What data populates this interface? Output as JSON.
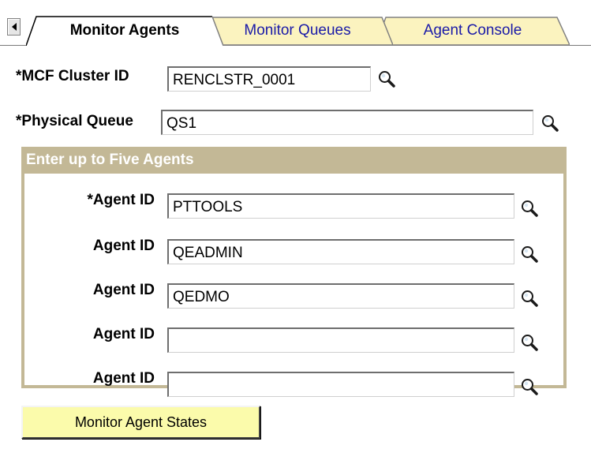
{
  "tabs": [
    {
      "label": "Monitor Agents",
      "active": true
    },
    {
      "label": "Monitor Queues",
      "active": false
    },
    {
      "label": "Agent Console",
      "active": false
    }
  ],
  "form": {
    "cluster": {
      "label": "*MCF Cluster ID",
      "value": "RENCLSTR_0001"
    },
    "queue": {
      "label": "*Physical Queue",
      "value": "QS1"
    }
  },
  "agents_group": {
    "title": "Enter up to Five Agents",
    "rows": [
      {
        "label": "*Agent ID",
        "value": "PTTOOLS"
      },
      {
        "label": "Agent ID",
        "value": "QEADMIN"
      },
      {
        "label": "Agent ID",
        "value": "QEDMO"
      },
      {
        "label": "Agent ID",
        "value": ""
      },
      {
        "label": "Agent ID",
        "value": ""
      }
    ]
  },
  "actions": {
    "monitor_label": "Monitor Agent States"
  },
  "colors": {
    "tab_active_bg": "#ffffff",
    "tab_inactive_bg": "#fbf3bf",
    "tab_inactive_text": "#1a1aa8",
    "group_header_bg": "#c3b896",
    "button_bg": "#fbfbab"
  },
  "icons": {
    "tab_scroll": "triangle-left-icon",
    "lookup": "magnifier-icon"
  }
}
